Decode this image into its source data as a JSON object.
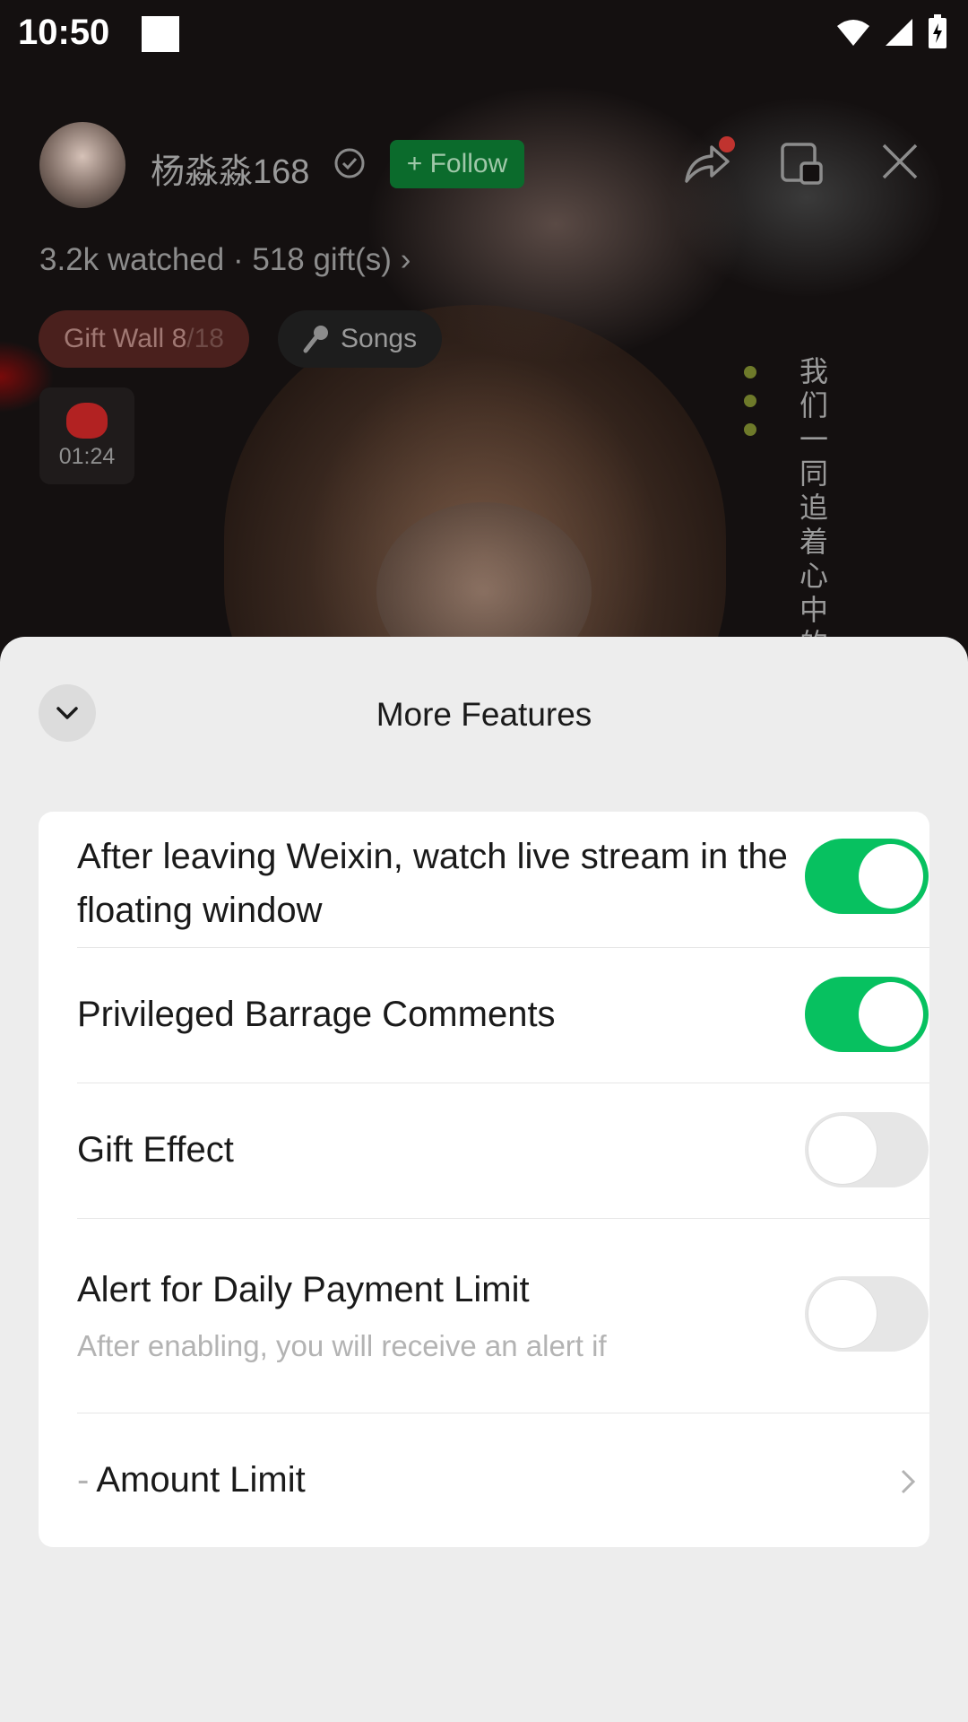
{
  "status_bar": {
    "time": "10:50"
  },
  "live": {
    "anchor_name": "杨淼淼168",
    "follow_label": "+ Follow",
    "stats": "3.2k watched · 518 gift(s)",
    "gift_wall_label": "Gift Wall",
    "gift_wall_count": "8",
    "gift_wall_total": "/18",
    "songs_label": "Songs",
    "red_packet_timer": "01:24",
    "vertical_caption": "我们一同追着心中的"
  },
  "sheet": {
    "title": "More Features",
    "rows": [
      {
        "label": "After leaving Weixin, watch live stream in the floating window",
        "toggle": true
      },
      {
        "label": "Privileged Barrage Comments",
        "toggle": true
      },
      {
        "label": "Gift Effect",
        "toggle": false
      },
      {
        "label": "Alert for Daily Payment Limit",
        "sub": "After enabling, you will receive an alert if",
        "toggle": false
      },
      {
        "prefix": "-",
        "label": "Amount Limit"
      }
    ]
  },
  "colors": {
    "accent": "#07c160",
    "sheet_bg": "#ededed"
  }
}
